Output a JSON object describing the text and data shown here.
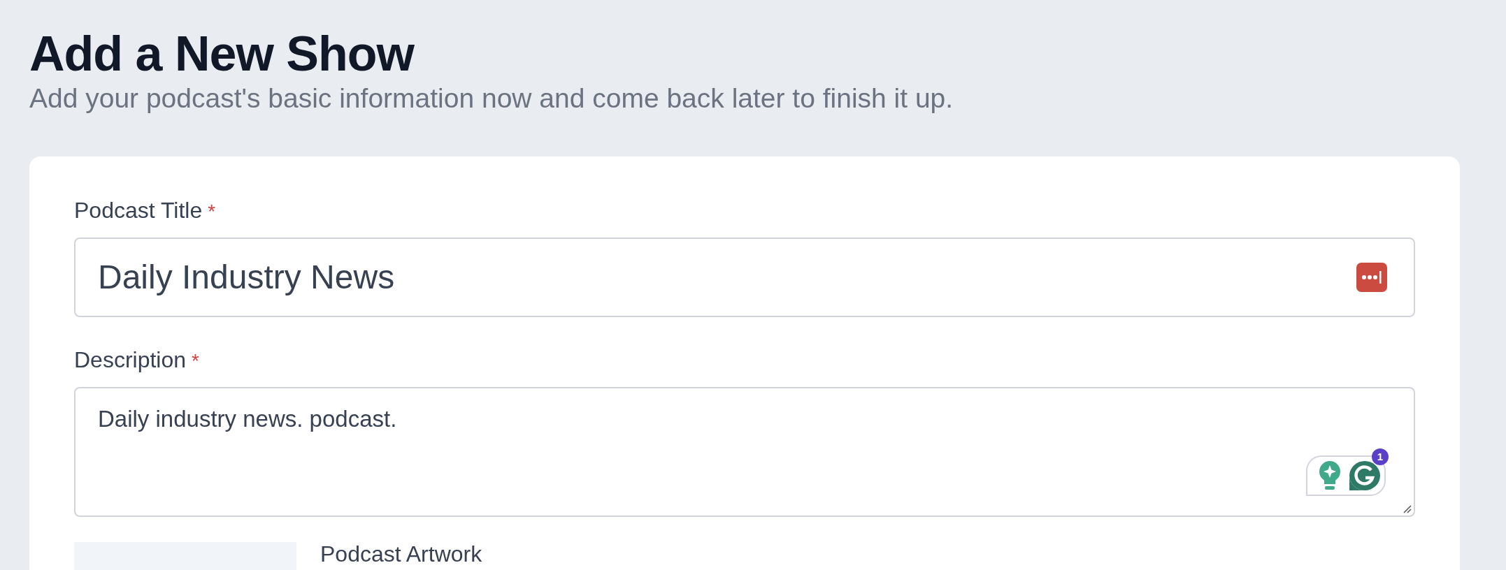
{
  "page": {
    "title": "Add a New Show",
    "subtitle": "Add your podcast's basic information now and come back later to finish it up."
  },
  "fields": [
    {
      "kind": "input",
      "label": "Podcast Title",
      "required_mark": "*",
      "value": "Daily Industry News"
    },
    {
      "kind": "textarea",
      "label": "Description",
      "required_mark": "*",
      "value": "Daily industry news. podcast.",
      "assistant_badge": "1"
    }
  ],
  "artwork": {
    "label": "Podcast Artwork"
  }
}
